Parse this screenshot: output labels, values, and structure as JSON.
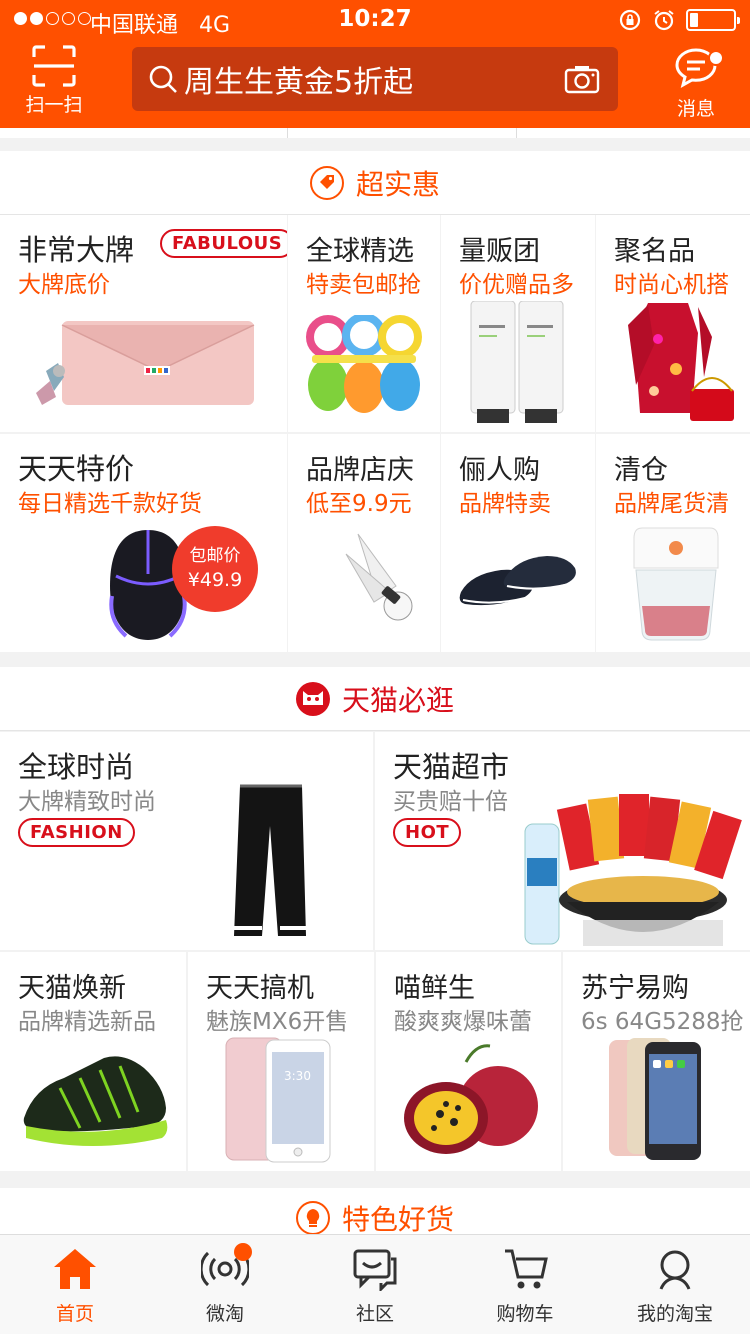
{
  "status_bar": {
    "carrier": "中国联通",
    "network": "4G",
    "time": "10:27"
  },
  "header": {
    "scan_label": "扫一扫",
    "search_placeholder": "周生生黄金5折起",
    "message_label": "消息"
  },
  "section_deals": {
    "title": "超实惠",
    "cells": [
      {
        "title": "非常大牌",
        "subtitle": "大牌底价",
        "tag": "FABULOUS"
      },
      {
        "title": "全球精选",
        "subtitle": "特卖包邮抢"
      },
      {
        "title": "量贩团",
        "subtitle": "价优赠品多"
      },
      {
        "title": "聚名品",
        "subtitle": "时尚心机搭"
      },
      {
        "title": "天天特价",
        "subtitle": "每日精选千款好货",
        "badge_line1": "包邮价",
        "badge_line2": "¥49.9"
      },
      {
        "title": "品牌店庆",
        "subtitle": "低至9.9元"
      },
      {
        "title": "俪人购",
        "subtitle": "品牌特卖"
      },
      {
        "title": "清仓",
        "subtitle": "品牌尾货清"
      }
    ]
  },
  "section_tmall": {
    "title": "天猫必逛",
    "cells": [
      {
        "title": "全球时尚",
        "subtitle": "大牌精致时尚",
        "tag": "FASHION"
      },
      {
        "title": "天猫超市",
        "subtitle": "买贵赔十倍",
        "tag": "HOT"
      },
      {
        "title": "天猫焕新",
        "subtitle": "品牌精选新品"
      },
      {
        "title": "天天搞机",
        "subtitle": "魅族MX6开售"
      },
      {
        "title": "喵鲜生",
        "subtitle": "酸爽爽爆味蕾"
      },
      {
        "title": "苏宁易购",
        "subtitle": "6s 64G5288抢"
      }
    ]
  },
  "section_special": {
    "title": "特色好货"
  },
  "tabbar": {
    "tabs": [
      {
        "label": "首页",
        "icon": "home-icon",
        "active": true
      },
      {
        "label": "微淘",
        "icon": "broadcast-icon"
      },
      {
        "label": "社区",
        "icon": "chat-icon"
      },
      {
        "label": "购物车",
        "icon": "cart-icon"
      },
      {
        "label": "我的淘宝",
        "icon": "user-icon"
      }
    ]
  },
  "colors": {
    "brand": "#ff5000",
    "search_bg": "#c63a0f",
    "tag_red": "#d80f1b",
    "tmall_red": "#d80f1b"
  }
}
